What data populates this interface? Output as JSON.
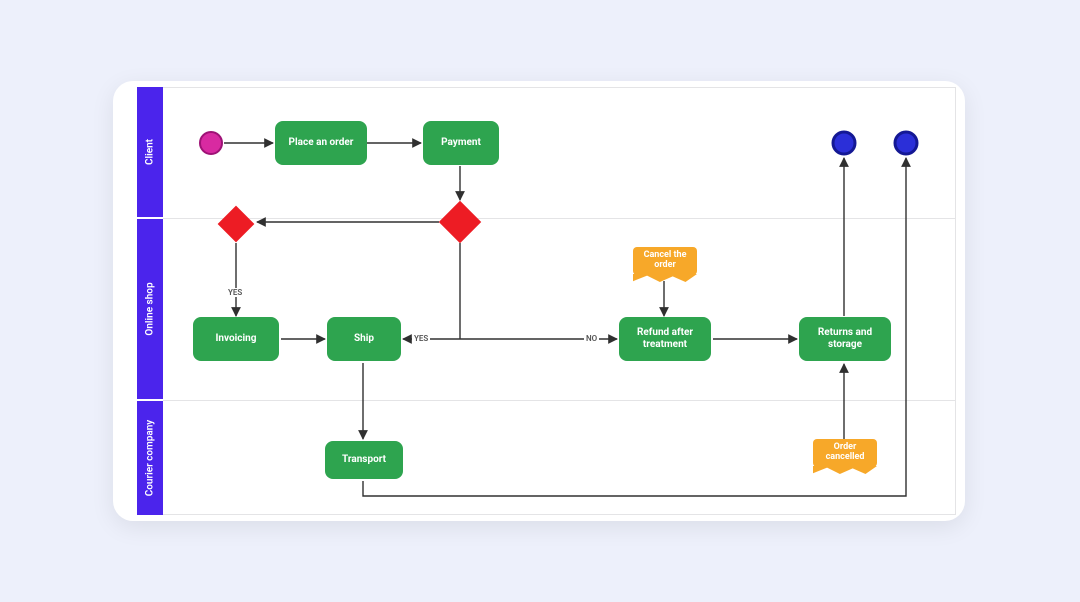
{
  "lanes": {
    "client": "Client",
    "shop": "Online shop",
    "courier": "Courier company"
  },
  "nodes": {
    "place_order": "Place an order",
    "payment": "Payment",
    "invoicing": "Invoicing",
    "ship": "Ship",
    "refund": "Refund after treatment",
    "returns": "Returns and storage",
    "transport": "Transport"
  },
  "annotations": {
    "cancel_order": "Cancel the order",
    "order_cancelled": "Order cancelled"
  },
  "edge_labels": {
    "yes_left": "YES",
    "yes_mid": "YES",
    "no": "NO"
  },
  "colors": {
    "lane_header": "#4b24ec",
    "process": "#2ea44f",
    "decision": "#ed1c24",
    "annotation": "#f7a829",
    "start_event": "#d82aa1",
    "end_event": "#2b2fd8",
    "edge": "#303030"
  }
}
